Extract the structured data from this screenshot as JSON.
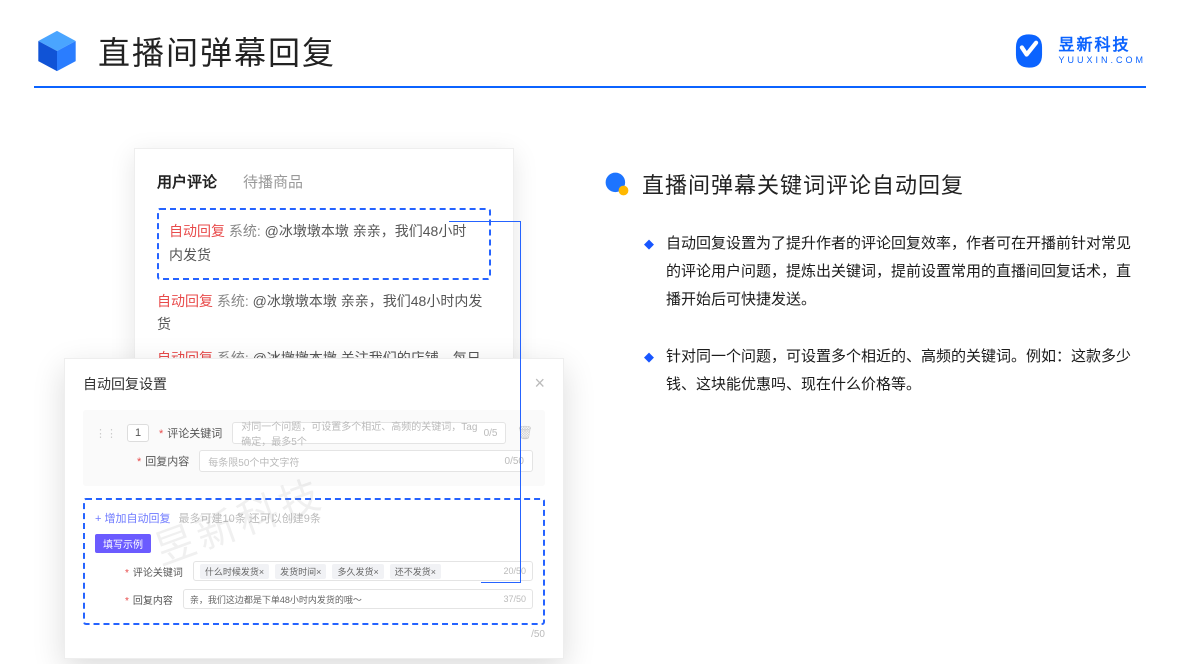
{
  "header": {
    "title": "直播间弹幕回复",
    "brand_cn": "昱新科技",
    "brand_en": "YUUXIN.COM"
  },
  "comments_card": {
    "tab_active": "用户评论",
    "tab_other": "待播商品",
    "rows": [
      {
        "tag": "自动回复",
        "sys": "系统:",
        "text": "@冰墩墩本墩 亲亲，我们48小时内发货"
      },
      {
        "tag": "自动回复",
        "sys": "系统:",
        "text": "@冰墩墩本墩 亲亲，我们48小时内发货"
      },
      {
        "tag": "自动回复",
        "sys": "系统:",
        "text": "@冰墩墩本墩 关注我们的店铺，每日都有热门推荐呦～"
      }
    ]
  },
  "settings_card": {
    "title": "自动回复设置",
    "idx": "1",
    "label_keyword": "评论关键词",
    "label_content": "回复内容",
    "ph_keyword": "对同一个问题，可设置多个相近、高频的关键词，Tag确定，最多5个",
    "ph_content": "每条限50个中文字符",
    "cnt_keyword": "0/5",
    "cnt_content": "0/50",
    "add_link": "+ 增加自动回复",
    "add_hint": "最多可建10条 还可以创建9条",
    "pill": "填写示例",
    "ex_keywords": [
      "什么时候发货×",
      "发货时间×",
      "多久发货×",
      "还不发货×"
    ],
    "ex_kw_cnt": "20/50",
    "ex_content": "亲，我们这边都是下单48小时内发货的哦～",
    "ex_ct_cnt": "37/50",
    "extra_cnt": "/50"
  },
  "right": {
    "title": "直播间弹幕关键词评论自动回复",
    "p1": "自动回复设置为了提升作者的评论回复效率，作者可在开播前针对常见的评论用户问题，提炼出关键词，提前设置常用的直播间回复话术，直播开始后可快捷发送。",
    "p2": "针对同一个问题，可设置多个相近的、高频的关键词。例如：这款多少钱、这块能优惠吗、现在什么价格等。"
  },
  "watermark": "昱新科技"
}
